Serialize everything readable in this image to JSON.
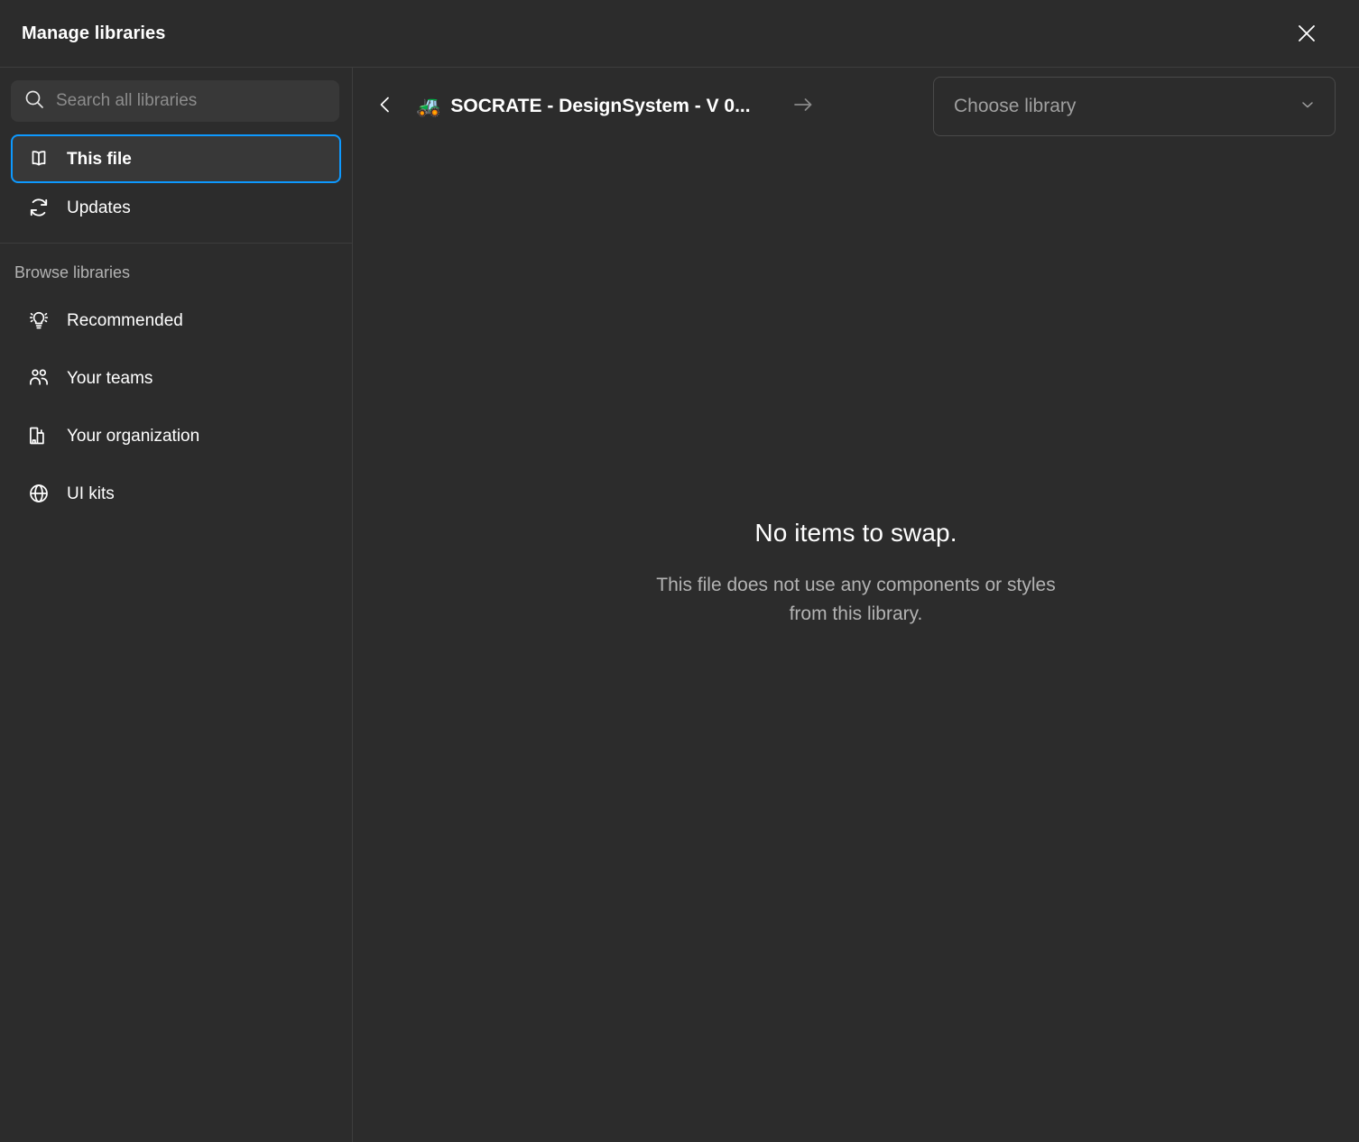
{
  "window": {
    "title": "Manage libraries",
    "close_icon": "close-icon"
  },
  "sidebar": {
    "search": {
      "placeholder": "Search all libraries",
      "value": "",
      "icon": "search-icon"
    },
    "primary_items": [
      {
        "label": "This file",
        "icon": "book-open-icon",
        "selected": true
      },
      {
        "label": "Updates",
        "icon": "refresh-icon",
        "selected": false
      }
    ],
    "browse_label": "Browse libraries",
    "browse_items": [
      {
        "label": "Recommended",
        "icon": "lightbulb-icon"
      },
      {
        "label": "Your teams",
        "icon": "people-icon"
      },
      {
        "label": "Your organization",
        "icon": "buildings-icon"
      },
      {
        "label": "UI kits",
        "icon": "globe-icon"
      }
    ]
  },
  "main": {
    "back_icon": "chevron-left-icon",
    "forward_icon": "arrow-right-icon",
    "library": {
      "emoji": "🚜",
      "name": "SOCRATE - DesignSystem - V 0..."
    },
    "choose_library": {
      "label": "Choose library",
      "icon": "chevron-down-icon"
    },
    "empty_state": {
      "title": "No items to swap.",
      "subtitle": "This file does not use any components or styles from this library."
    }
  },
  "colors": {
    "background": "#2C2C2C",
    "surface": "#383838",
    "accent": "#0D99FF",
    "border": "#3D3D3D",
    "text_primary": "#FFFFFF",
    "text_secondary": "#B3B3B3",
    "text_muted": "#8C8C8C"
  }
}
